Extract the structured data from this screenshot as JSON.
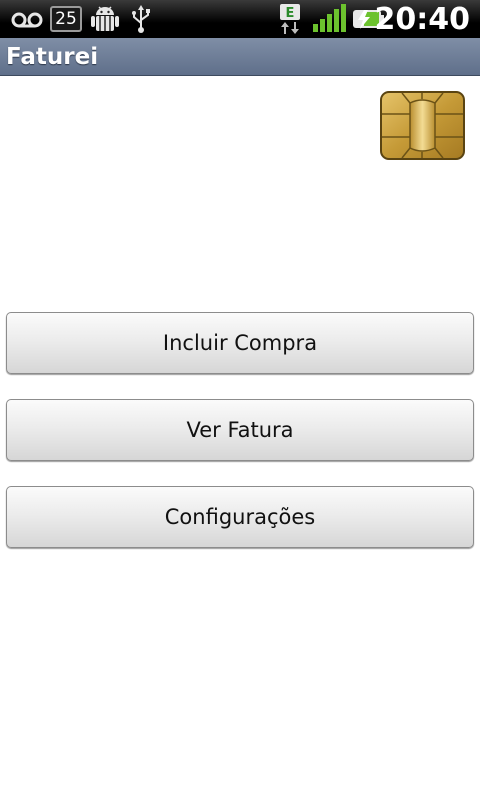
{
  "status_bar": {
    "notification_count": "25",
    "network_type": "E",
    "clock": "20:40",
    "icons": [
      "voicemail-icon",
      "notification-count-icon",
      "android-debug-icon",
      "usb-icon",
      "edge-network-icon",
      "signal-icon",
      "battery-charging-icon"
    ]
  },
  "app": {
    "title": "Faturei",
    "logo": "card-chip-icon"
  },
  "buttons": {
    "add_purchase": "Incluir Compra",
    "view_invoice": "Ver Fatura",
    "settings": "Configurações"
  },
  "colors": {
    "title_bar": "#6f7f99",
    "status_bar": "#000000",
    "accent_green": "#6cc22e",
    "chip_gold": "#c9a441"
  }
}
